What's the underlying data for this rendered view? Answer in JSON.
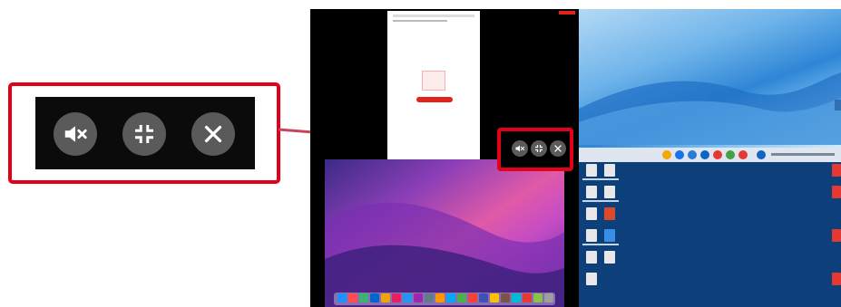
{
  "callout": {
    "label": "",
    "buttons": [
      {
        "icon": "mute-icon"
      },
      {
        "icon": "fullscreen-icon"
      },
      {
        "icon": "close-icon"
      }
    ]
  },
  "remote_screens": [
    {
      "name": "iphone-screen"
    },
    {
      "name": "windows-desktop-top"
    },
    {
      "name": "macos-desktop"
    },
    {
      "name": "windows-desktop-bottom"
    }
  ],
  "colors": {
    "highlight": "#e3001b",
    "button_bg": "#5a5a5a",
    "icon": "#ffffff"
  }
}
